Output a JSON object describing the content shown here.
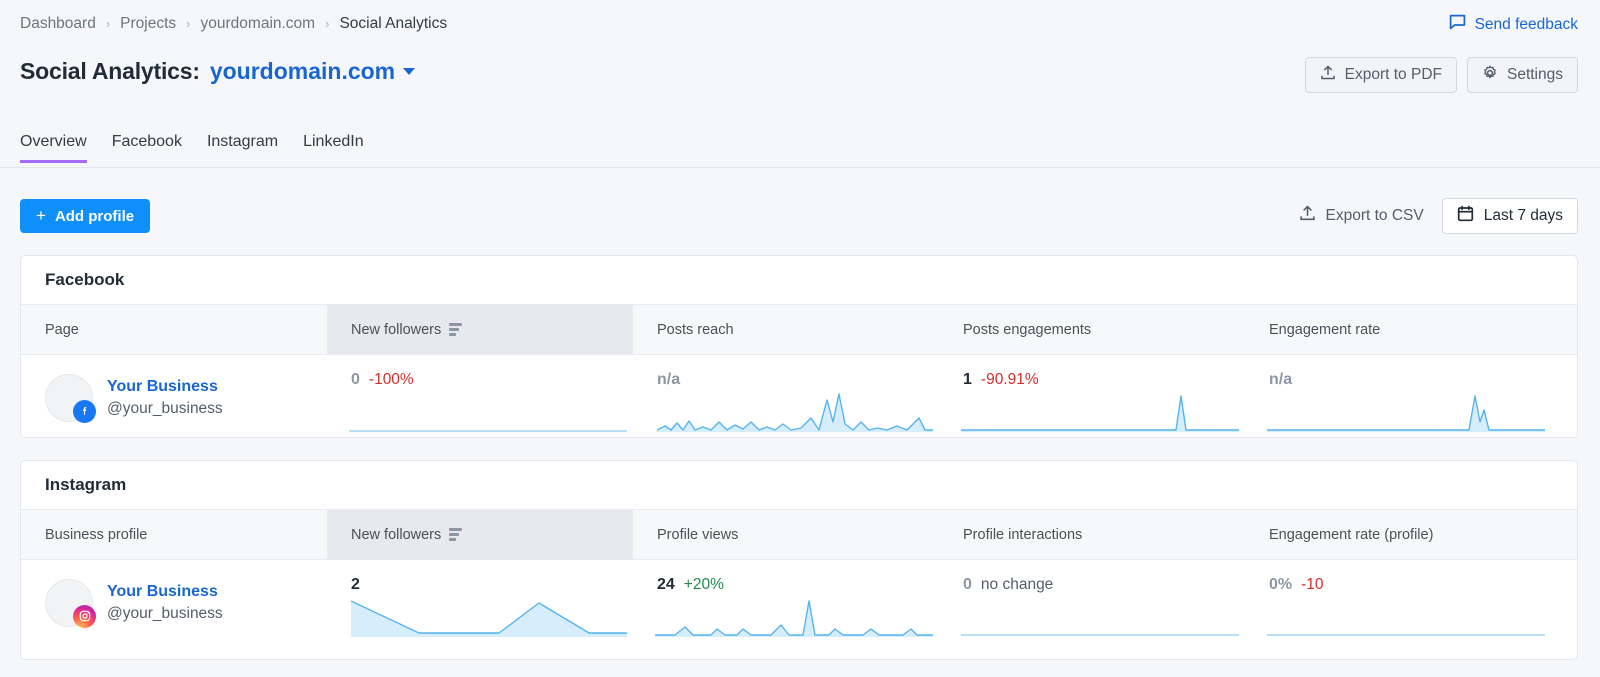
{
  "breadcrumb": {
    "items": [
      "Dashboard",
      "Projects",
      "yourdomain.com",
      "Social Analytics"
    ],
    "separator": "›"
  },
  "header": {
    "send_feedback": "Send feedback",
    "title": "Social Analytics:",
    "domain": "yourdomain.com",
    "export_pdf": "Export to PDF",
    "settings": "Settings"
  },
  "tabs": [
    {
      "label": "Overview",
      "active": true
    },
    {
      "label": "Facebook",
      "active": false
    },
    {
      "label": "Instagram",
      "active": false
    },
    {
      "label": "LinkedIn",
      "active": false
    }
  ],
  "toolbar": {
    "add_profile": "Add profile",
    "add_profile_plus": "+",
    "export_csv": "Export to CSV",
    "date_range": "Last 7 days"
  },
  "colors": {
    "accent_blue": "#0e8ffc",
    "link_blue": "#1a66d1",
    "tab_active": "#a46bf5",
    "negative": "#d62b2b",
    "positive": "#1e8a4c",
    "spark_line": "#55b4ef",
    "spark_fill": "#d6eefb"
  },
  "cards": [
    {
      "id": "facebook",
      "title": "Facebook",
      "columns": [
        "Page",
        "New followers",
        "Posts reach",
        "Posts engagements",
        "Engagement rate"
      ],
      "sorted_column": "New followers",
      "row": {
        "profile_name": "Your Business",
        "profile_handle": "@your_business",
        "network_icon": "facebook-icon",
        "metrics": [
          {
            "name": "new-followers",
            "value": "0",
            "value_muted": true,
            "delta": "-100%",
            "delta_dir": "neg"
          },
          {
            "name": "posts-reach",
            "value": "n/a",
            "value_muted": true,
            "delta": "",
            "delta_dir": "none"
          },
          {
            "name": "posts-engagements",
            "value": "1",
            "value_muted": false,
            "delta": "-90.91%",
            "delta_dir": "neg"
          },
          {
            "name": "engagement-rate",
            "value": "n/a",
            "value_muted": true,
            "delta": "",
            "delta_dir": "none"
          }
        ]
      }
    },
    {
      "id": "instagram",
      "title": "Instagram",
      "columns": [
        "Business profile",
        "New followers",
        "Profile views",
        "Profile interactions",
        "Engagement rate (profile)"
      ],
      "sorted_column": "New followers",
      "row": {
        "profile_name": "Your Business",
        "profile_handle": "@your_business",
        "network_icon": "instagram-icon",
        "metrics": [
          {
            "name": "new-followers",
            "value": "2",
            "value_muted": false,
            "delta": "",
            "delta_dir": "none"
          },
          {
            "name": "profile-views",
            "value": "24",
            "value_muted": false,
            "delta": "+20%",
            "delta_dir": "pos"
          },
          {
            "name": "profile-interactions",
            "value": "0",
            "value_muted": true,
            "delta": "no change",
            "delta_dir": "flat"
          },
          {
            "name": "engagement-rate-profile",
            "value": "0%",
            "value_muted": true,
            "delta": "-10",
            "delta_dir": "neg"
          }
        ]
      }
    }
  ],
  "chart_data": [
    {
      "type": "area",
      "title": "Facebook – New followers sparkline",
      "series": [
        {
          "name": "New followers",
          "values": [
            0,
            0,
            0,
            0,
            0,
            0,
            0,
            0,
            0,
            0,
            0,
            0,
            0,
            0
          ]
        }
      ],
      "ylim": [
        0,
        1
      ],
      "grid": false,
      "legend": "none"
    },
    {
      "type": "area",
      "title": "Facebook – Posts reach sparkline",
      "series": [
        {
          "name": "Posts reach",
          "values": [
            1,
            3,
            1,
            4,
            2,
            5,
            1,
            2,
            1,
            4,
            1,
            3,
            2,
            4,
            1,
            2,
            1,
            3,
            1,
            2,
            6,
            2,
            18,
            4,
            22,
            3,
            1,
            4,
            2,
            1,
            3,
            2,
            1,
            5
          ]
        }
      ],
      "ylim": [
        0,
        24
      ],
      "grid": false,
      "legend": "none"
    },
    {
      "type": "area",
      "title": "Facebook – Posts engagements sparkline",
      "series": [
        {
          "name": "Posts engagements",
          "values": [
            0,
            0,
            0,
            0,
            0,
            0,
            0,
            0,
            0,
            0,
            0,
            0,
            0,
            0,
            0,
            0,
            0,
            0,
            0,
            0,
            0,
            0,
            0,
            0,
            11,
            0,
            0,
            0,
            0,
            0
          ]
        }
      ],
      "ylim": [
        0,
        11
      ],
      "grid": false,
      "legend": "none"
    },
    {
      "type": "area",
      "title": "Facebook – Engagement rate sparkline",
      "series": [
        {
          "name": "Engagement rate",
          "values": [
            0,
            0,
            0,
            0,
            0,
            0,
            0,
            0,
            0,
            0,
            0,
            0,
            0,
            0,
            0,
            0,
            0,
            0,
            0,
            0,
            0,
            0,
            0,
            10,
            2,
            6,
            0,
            0,
            0,
            0
          ]
        }
      ],
      "ylim": [
        0,
        10
      ],
      "grid": false,
      "legend": "none"
    },
    {
      "type": "area",
      "title": "Instagram – New followers sparkline",
      "series": [
        {
          "name": "New followers",
          "values": [
            2,
            1,
            0,
            0,
            0,
            0,
            1,
            2,
            1,
            0,
            0
          ]
        }
      ],
      "ylim": [
        0,
        2
      ],
      "grid": false,
      "legend": "none"
    },
    {
      "type": "area",
      "title": "Instagram – Profile views sparkline",
      "series": [
        {
          "name": "Profile views",
          "values": [
            0,
            0,
            0,
            2,
            0,
            1,
            0,
            1,
            0,
            0,
            2,
            0,
            0,
            9,
            0,
            1,
            0,
            0,
            1,
            0,
            0,
            1,
            0
          ]
        }
      ],
      "ylim": [
        0,
        9
      ],
      "grid": false,
      "legend": "none"
    },
    {
      "type": "area",
      "title": "Instagram – Profile interactions sparkline",
      "series": [
        {
          "name": "Profile interactions",
          "values": [
            0,
            0,
            0,
            0,
            0,
            0,
            0,
            0,
            0,
            0,
            0,
            0
          ]
        }
      ],
      "ylim": [
        0,
        1
      ],
      "grid": false,
      "legend": "none"
    },
    {
      "type": "area",
      "title": "Instagram – Engagement rate (profile) sparkline",
      "series": [
        {
          "name": "Engagement rate (profile)",
          "values": [
            0,
            0,
            0,
            0,
            0,
            0,
            0,
            0,
            0,
            0,
            0,
            0
          ]
        }
      ],
      "ylim": [
        0,
        1
      ],
      "grid": false,
      "legend": "none"
    }
  ]
}
